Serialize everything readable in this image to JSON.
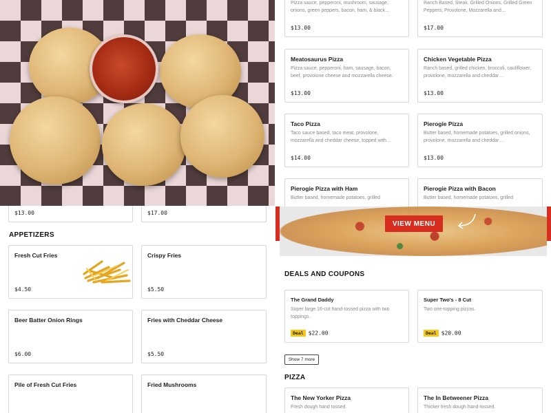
{
  "left_panel": {
    "partial_prices": [
      "$13.00",
      "$17.00"
    ],
    "appetizers": {
      "title": "APPETIZERS",
      "items": [
        {
          "name": "Fresh Cut Fries",
          "price": "$4.50",
          "image": "fries-image"
        },
        {
          "name": "Crispy Fries",
          "price": "$5.50"
        },
        {
          "name": "Beer Batter Onion Rings",
          "price": "$6.00"
        },
        {
          "name": "Fries with Cheddar Cheese",
          "price": "$5.50"
        },
        {
          "name": "Pile of Fresh Cut Fries"
        },
        {
          "name": "Fried Mushrooms"
        }
      ]
    }
  },
  "right_panel": {
    "specialty_pizzas": [
      {
        "desc": "Pizza sauce, pepperoni, mushroom, sausage, onions, green peppers, bacon, ham, & black…",
        "price": "$13.00"
      },
      {
        "desc": "Ranch Based, Steak, Grilled Onions, Grilled Green Peppers, Provolone, Mozzarella and…",
        "price": "$17.00"
      },
      {
        "name": "Meatosaurus Pizza",
        "desc": "Pizza sauce, pepperoni, ham, sausage, bacon, beef, provolone cheese and mozzarella cheese.",
        "price": "$13.00"
      },
      {
        "name": "Chicken Vegetable Pizza",
        "desc": "Ranch based, grilled chicken, broccoli, cauliflower, provolone, mozzarella and cheddar…",
        "price": "$13.00"
      },
      {
        "name": "Taco Pizza",
        "desc": "Taco sauce based, taco meat, provolone, mozzarella and cheddar cheese, topped with…",
        "price": "$14.00"
      },
      {
        "name": "Pierogie Pizza",
        "desc": "Butter based, homemade potatoes, grilled onions, provolone, mozzarella and cheddar…",
        "price": "$13.00"
      },
      {
        "name": "Pierogie Pizza with Ham",
        "desc": "Butter based, homemade potatoes, grilled"
      },
      {
        "name": "Pierogie Pizza with Bacon",
        "desc": "Butter based, homemade potatoes, grilled"
      }
    ],
    "promo": {
      "button": "VIEW MENU"
    },
    "deals": {
      "title": "DEALS AND COUPONS",
      "items": [
        {
          "name": "The Grand Daddy",
          "desc": "Super large 16-cut hand-tossed pizza with two toppings.",
          "tag": "Deal",
          "price": "$22.00"
        },
        {
          "name": "Super Two's - 8 Cut",
          "desc": "Two one-topping pizzas.",
          "tag": "Deal",
          "price": "$20.00"
        }
      ],
      "show_more": "Show 7 more"
    },
    "pizza": {
      "title": "PIZZA",
      "items": [
        {
          "name": "The New Yorker Pizza",
          "desc": "Fresh dough hand tossed."
        },
        {
          "name": "The In Betweener Pizza",
          "desc": "Thicker fresh dough hand-tossed."
        }
      ]
    }
  },
  "colors": {
    "accent": "#d62d1f",
    "deal_tag": "#f5c518"
  }
}
